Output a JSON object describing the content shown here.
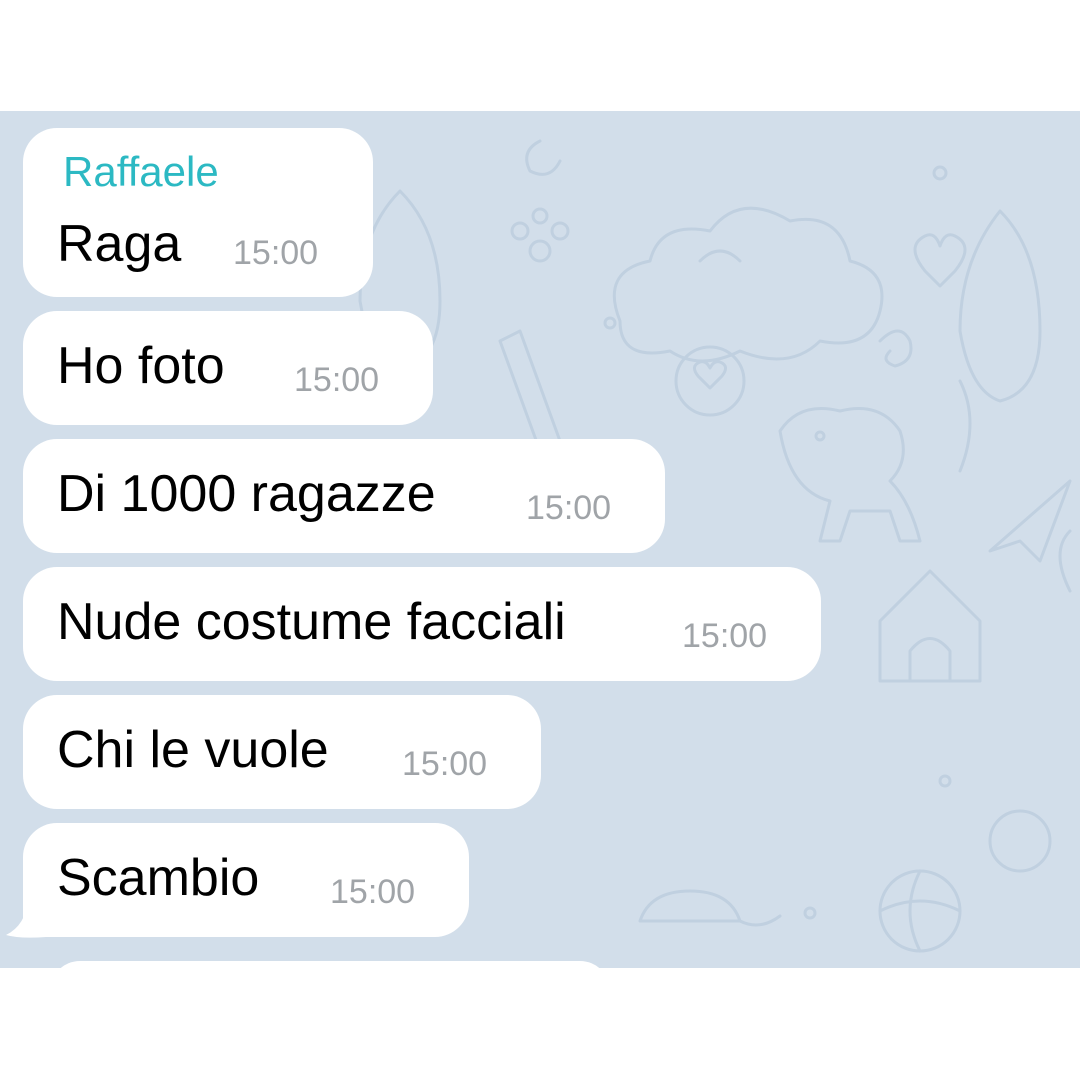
{
  "chat": {
    "sender": "Raffaele",
    "sender_color": "#2cb9c3",
    "background_color": "#d2deea",
    "messages": [
      {
        "text": "Raga",
        "time": "15:00"
      },
      {
        "text": "Ho foto",
        "time": "15:00"
      },
      {
        "text": "Di 1000 ragazze",
        "time": "15:00"
      },
      {
        "text": "Nude costume facciali",
        "time": "15:00"
      },
      {
        "text": "Chi le vuole",
        "time": "15:00"
      },
      {
        "text": "Scambio",
        "time": "15:00"
      }
    ]
  }
}
